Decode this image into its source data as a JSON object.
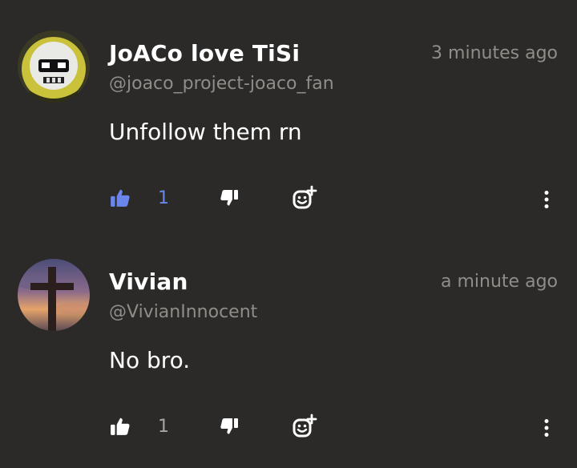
{
  "colors": {
    "background": "#2b2a28",
    "primary_text": "#ffffff",
    "secondary_text": "#8f8d88",
    "liked_accent": "#6a86ea",
    "unliked_count": "#a7a5a1"
  },
  "comments": [
    {
      "username": "JoACo love TiSi",
      "handle": "@joaco_project-joaco_fan",
      "timestamp": "3 minutes ago",
      "text": "Unfollow them rn",
      "like_count": "1",
      "liked": true,
      "avatar": "masked-face-avatar"
    },
    {
      "username": "Vivian",
      "handle": "@VivianInnocent",
      "timestamp": "a minute ago",
      "text": "No bro.",
      "like_count": "1",
      "liked": false,
      "avatar": "cross-sunset-avatar"
    }
  ],
  "icons": {
    "like": "thumbs-up-icon",
    "dislike": "thumbs-down-icon",
    "react": "add-reaction-icon",
    "more": "more-options-icon"
  }
}
